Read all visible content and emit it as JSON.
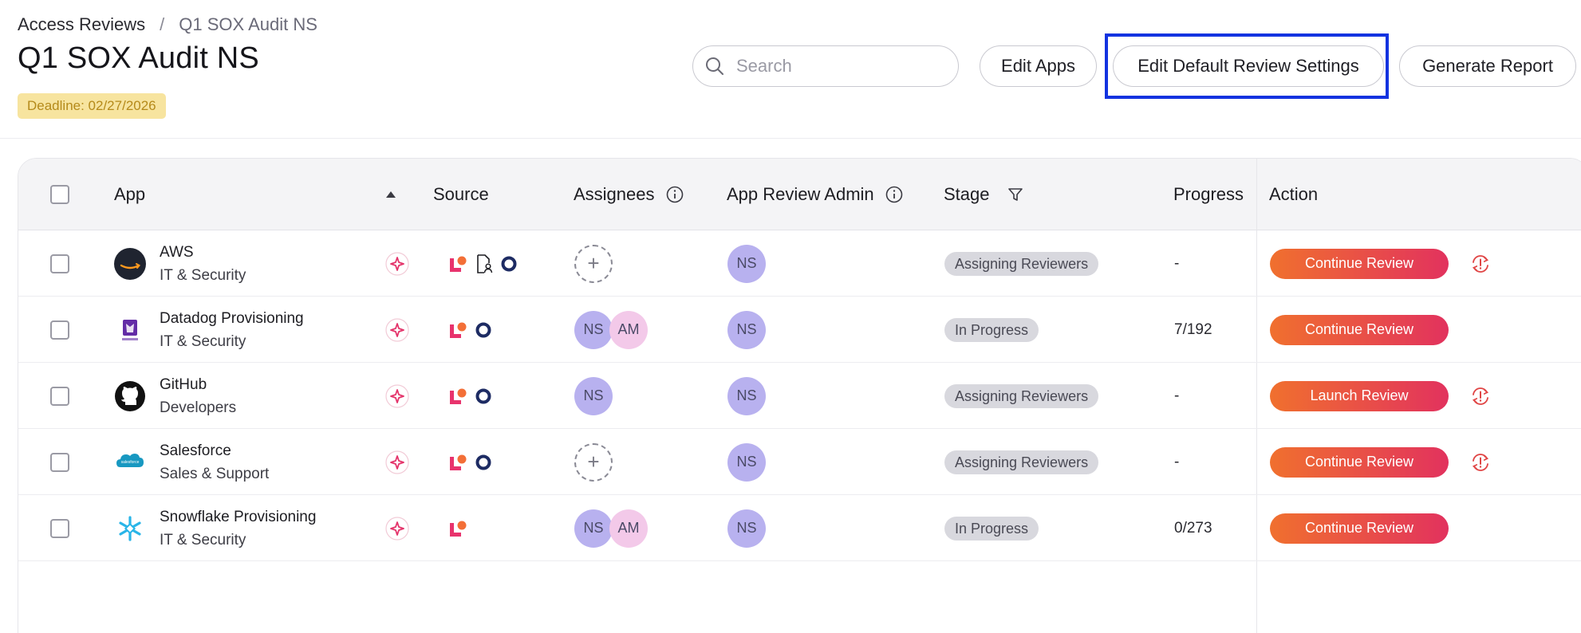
{
  "breadcrumb": {
    "root": "Access Reviews",
    "separator": "/",
    "current": "Q1 SOX Audit NS"
  },
  "page": {
    "title": "Q1 SOX Audit NS",
    "deadline": "Deadline: 02/27/2026"
  },
  "search": {
    "placeholder": "Search",
    "value": ""
  },
  "toolbar": {
    "edit_apps": "Edit Apps",
    "edit_default": "Edit Default Review Settings",
    "generate_report": "Generate Report"
  },
  "table": {
    "headers": {
      "app": "App",
      "source": "Source",
      "assignees": "Assignees",
      "admin": "App Review Admin",
      "stage": "Stage",
      "progress": "Progress",
      "action": "Action"
    },
    "rows": [
      {
        "name": "AWS",
        "category": "IT & Security",
        "logo": "aws-logo",
        "assignees": [],
        "admin": "NS",
        "stage": "Assigning Reviewers",
        "progress": "-",
        "action": "Continue Review",
        "alert": true,
        "sources": [
          "ai-sparkle",
          "lumos",
          "file-user",
          "okta"
        ]
      },
      {
        "name": "Datadog Provisioning",
        "category": "IT & Security",
        "logo": "datadog-logo",
        "assignees": [
          "NS",
          "AM"
        ],
        "admin": "NS",
        "stage": "In Progress",
        "progress": "7/192",
        "action": "Continue Review",
        "alert": false,
        "sources": [
          "ai-sparkle",
          "lumos",
          "okta"
        ]
      },
      {
        "name": "GitHub",
        "category": "Developers",
        "logo": "github-logo",
        "assignees": [
          "NS"
        ],
        "admin": "NS",
        "stage": "Assigning Reviewers",
        "progress": "-",
        "action": "Launch Review",
        "alert": true,
        "sources": [
          "ai-sparkle",
          "lumos",
          "okta"
        ]
      },
      {
        "name": "Salesforce",
        "category": "Sales & Support",
        "logo": "salesforce-logo",
        "assignees": [],
        "admin": "NS",
        "stage": "Assigning Reviewers",
        "progress": "-",
        "action": "Continue Review",
        "alert": true,
        "sources": [
          "ai-sparkle",
          "lumos",
          "okta"
        ]
      },
      {
        "name": "Snowflake Provisioning",
        "category": "IT & Security",
        "logo": "snowflake-logo",
        "assignees": [
          "NS",
          "AM"
        ],
        "admin": "NS",
        "stage": "In Progress",
        "progress": "0/273",
        "action": "Continue Review",
        "alert": false,
        "sources": [
          "ai-sparkle",
          "lumos"
        ]
      }
    ]
  },
  "colors": {
    "accent_start": "#f0702e",
    "accent_end": "#e2325e",
    "highlight": "#1333e0",
    "deadline_bg": "#f7e49f",
    "avatar_ns": "#b8b1ef",
    "avatar_am": "#f3c9e9"
  }
}
